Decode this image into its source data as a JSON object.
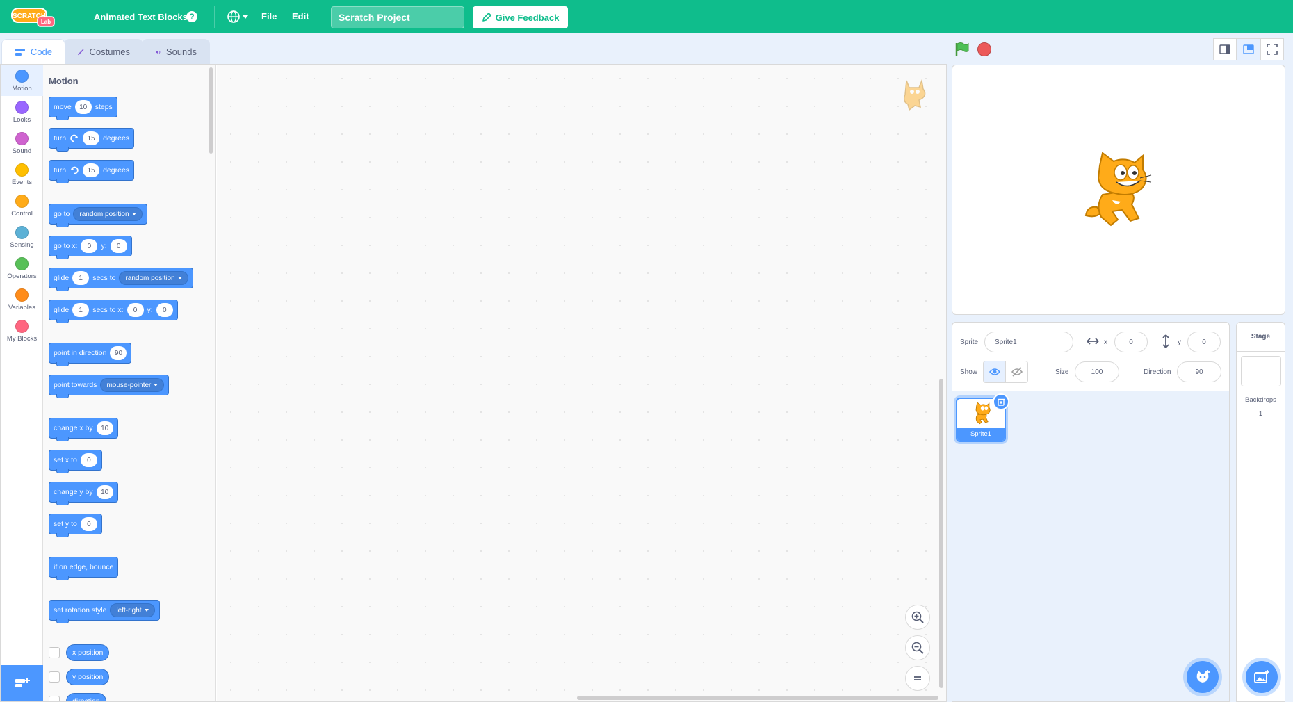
{
  "menubar": {
    "logo_text": "SCRATCH",
    "logo_badge": "Lab",
    "extension_title": "Animated Text Blocks",
    "help_symbol": "?",
    "file_label": "File",
    "edit_label": "Edit",
    "project_title": "Scratch Project",
    "feedback_label": "Give Feedback",
    "bg_color": "#0fbd8c"
  },
  "tabs": [
    {
      "label": "Code",
      "icon": "code-icon",
      "active": true
    },
    {
      "label": "Costumes",
      "icon": "brush-icon",
      "active": false
    },
    {
      "label": "Sounds",
      "icon": "speaker-icon",
      "active": false
    }
  ],
  "categories": [
    {
      "label": "Motion",
      "color": "#4c97ff"
    },
    {
      "label": "Looks",
      "color": "#9966ff"
    },
    {
      "label": "Sound",
      "color": "#cf63cf"
    },
    {
      "label": "Events",
      "color": "#ffbf00"
    },
    {
      "label": "Control",
      "color": "#ffab19"
    },
    {
      "label": "Sensing",
      "color": "#5cb1d6"
    },
    {
      "label": "Operators",
      "color": "#59c059"
    },
    {
      "label": "Variables",
      "color": "#ff8c1a"
    },
    {
      "label": "My Blocks",
      "color": "#ff6680"
    }
  ],
  "palette": {
    "heading": "Motion",
    "move": {
      "pre": "move",
      "value": "10",
      "post": "steps"
    },
    "turn_right": {
      "pre": "turn",
      "value": "15",
      "post": "degrees"
    },
    "turn_left": {
      "pre": "turn",
      "value": "15",
      "post": "degrees"
    },
    "goto": {
      "pre": "go to",
      "menu": "random position"
    },
    "goto_xy": {
      "pre": "go to x:",
      "x": "0",
      "mid": "y:",
      "y": "0"
    },
    "glide_to": {
      "pre": "glide",
      "value": "1",
      "mid": "secs to",
      "menu": "random position"
    },
    "glide_xy": {
      "pre": "glide",
      "value": "1",
      "mid": "secs to x:",
      "x": "0",
      "ylabel": "y:",
      "y": "0"
    },
    "point_dir": {
      "pre": "point in direction",
      "value": "90"
    },
    "point_towards": {
      "pre": "point towards",
      "menu": "mouse-pointer"
    },
    "change_x": {
      "pre": "change x by",
      "value": "10"
    },
    "set_x": {
      "pre": "set x to",
      "value": "0"
    },
    "change_y": {
      "pre": "change y by",
      "value": "10"
    },
    "set_y": {
      "pre": "set y to",
      "value": "0"
    },
    "bounce": {
      "pre": "if on edge, bounce"
    },
    "rotation_style": {
      "pre": "set rotation style",
      "menu": "left-right"
    },
    "reporters": [
      "x position",
      "y position",
      "direction"
    ]
  },
  "sprite_info": {
    "sprite_label": "Sprite",
    "sprite_name": "Sprite1",
    "x_label": "x",
    "x_value": "0",
    "y_label": "y",
    "y_value": "0",
    "show_label": "Show",
    "size_label": "Size",
    "size_value": "100",
    "direction_label": "Direction",
    "direction_value": "90"
  },
  "sprites": [
    {
      "name": "Sprite1",
      "selected": true
    }
  ],
  "stage_pane": {
    "title": "Stage",
    "backdrops_label": "Backdrops",
    "backdrops_count": "1"
  }
}
